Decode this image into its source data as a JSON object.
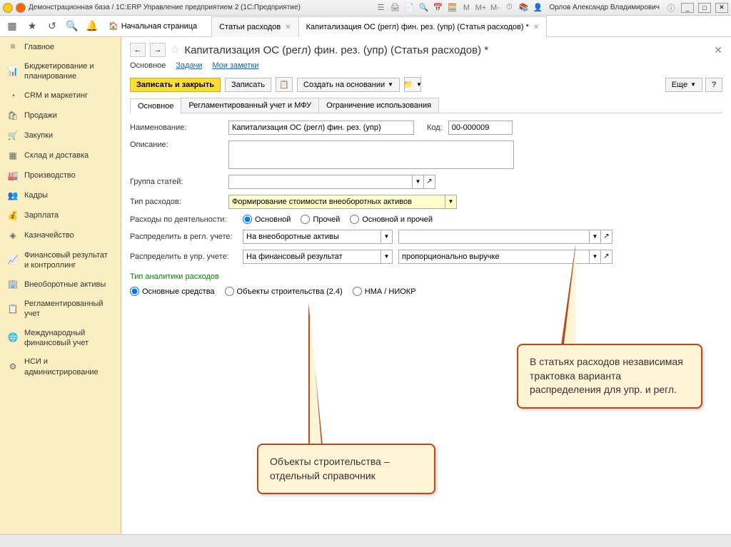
{
  "titlebar": {
    "title": "Демонстрационная база / 1С:ERP Управление предприятием 2  (1С:Предприятие)",
    "user": "Орлов Александр Владимирович",
    "m_plus": "M+",
    "m_minus": "M-"
  },
  "toolbar": {
    "home": "Начальная страница",
    "tab1": "Статьи расходов",
    "tab2": "Капитализация ОС (регл) фин. рез. (упр) (Статья расходов) *"
  },
  "sidebar": {
    "items": [
      {
        "icon": "≡",
        "label": "Главное"
      },
      {
        "icon": "📊",
        "label": "Бюджетирование и планирование"
      },
      {
        "icon": "◔",
        "label": "CRM и маркетинг"
      },
      {
        "icon": "🛍",
        "label": "Продажи"
      },
      {
        "icon": "🛒",
        "label": "Закупки"
      },
      {
        "icon": "▦",
        "label": "Склад и доставка"
      },
      {
        "icon": "🏭",
        "label": "Производство"
      },
      {
        "icon": "👥",
        "label": "Кадры"
      },
      {
        "icon": "💰",
        "label": "Зарплата"
      },
      {
        "icon": "◈",
        "label": "Казначейство"
      },
      {
        "icon": "📈",
        "label": "Финансовый результат и контроллинг"
      },
      {
        "icon": "🏢",
        "label": "Внеоборотные активы"
      },
      {
        "icon": "📋",
        "label": "Регламентированный учет"
      },
      {
        "icon": "🌐",
        "label": "Международный финансовый учет"
      },
      {
        "icon": "⚙",
        "label": "НСИ и администрирование"
      }
    ]
  },
  "page": {
    "title": "Капитализация ОС (регл) фин. рез. (упр) (Статья расходов) *",
    "sublinks": {
      "main": "Основное",
      "tasks": "Задачи",
      "notes": "Мои заметки"
    },
    "actions": {
      "save_close": "Записать и закрыть",
      "save": "Записать",
      "create_based": "Создать на основании",
      "more": "Еще",
      "help": "?"
    },
    "innertabs": {
      "t1": "Основное",
      "t2": "Регламентированный учет и МФУ",
      "t3": "Ограничение использования"
    },
    "form": {
      "name_label": "Наименование:",
      "name_value": "Капитализация ОС (регл) фин. рез. (упр)",
      "code_label": "Код:",
      "code_value": "00-000009",
      "desc_label": "Описание:",
      "group_label": "Группа статей:",
      "type_label": "Тип расходов:",
      "type_value": "Формирование стоимости  внеоборотных активов",
      "activity_label": "Расходы по деятельности:",
      "activity_options": {
        "r1": "Основной",
        "r2": "Прочей",
        "r3": "Основной и прочей"
      },
      "distr_regl_label": "Распределить в регл. учете:",
      "distr_regl_value": "На внеоборотные активы",
      "distr_upr_label": "Распределить в упр. учете:",
      "distr_upr_value": "На финансовый результат",
      "distr_upr_extra": "пропорционально выручке",
      "analytics_title": "Тип аналитики расходов",
      "analytics_options": {
        "r1": "Основные средства",
        "r2": "Объекты строительства (2.4)",
        "r3": "НМА / НИОКР"
      }
    }
  },
  "callouts": {
    "right": "В статьях расходов независимая трактовка варианта распределения для упр. и регл.",
    "left": "Объекты строительства – отдельный справочник"
  }
}
